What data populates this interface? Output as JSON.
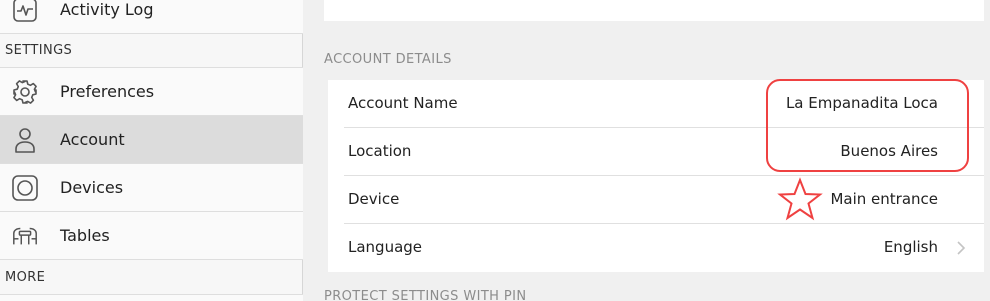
{
  "sidebar": {
    "items": [
      {
        "label": "Activity Log"
      },
      {
        "label": "Preferences"
      },
      {
        "label": "Account"
      },
      {
        "label": "Devices"
      },
      {
        "label": "Tables"
      }
    ],
    "sections": {
      "settings": "SETTINGS",
      "more": "MORE"
    }
  },
  "main": {
    "account_details_header": "ACCOUNT DETAILS",
    "rows": [
      {
        "label": "Account Name",
        "value": "La Empanadita Loca"
      },
      {
        "label": "Location",
        "value": "Buenos Aires"
      },
      {
        "label": "Device",
        "value": "Main entrance"
      },
      {
        "label": "Language",
        "value": "English"
      }
    ],
    "protect_header": "PROTECT SETTINGS WITH PIN"
  },
  "colors": {
    "accent_annotation": "#ef4141",
    "selected_bg": "#dcdcdc"
  },
  "icons": [
    "activity-icon",
    "gear-icon",
    "person-icon",
    "device-icon",
    "tables-icon",
    "chevron-right-icon"
  ]
}
